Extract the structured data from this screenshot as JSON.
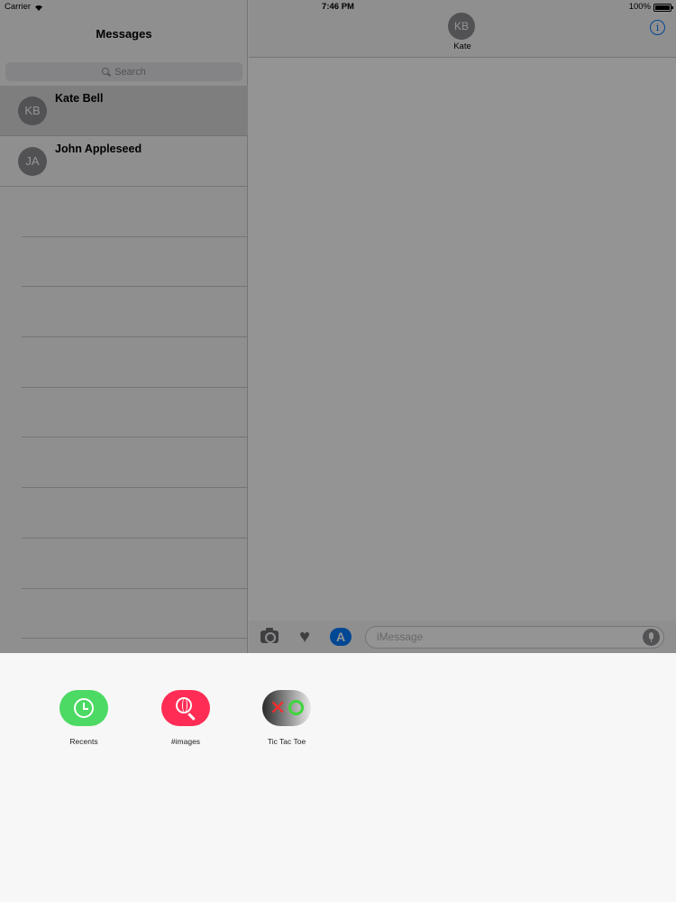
{
  "status_bar": {
    "carrier": "Carrier",
    "time": "7:46 PM",
    "battery": "100%"
  },
  "sidebar": {
    "title": "Messages",
    "search_placeholder": "Search",
    "conversations": [
      {
        "initials": "KB",
        "name": "Kate Bell",
        "selected": true
      },
      {
        "initials": "JA",
        "name": "John Appleseed",
        "selected": false
      }
    ]
  },
  "conversation": {
    "initials": "KB",
    "name": "Kate",
    "message_placeholder": "iMessage"
  },
  "drawer": {
    "apps": [
      {
        "label": "Recents",
        "icon": "clock-icon",
        "color": "#4cd964"
      },
      {
        "label": "#images",
        "icon": "globe-search-icon",
        "color": "#ff2d55"
      },
      {
        "label": "Tic Tac Toe",
        "icon": "tic-tac-toe-icon",
        "color": "#8a8a8a"
      }
    ]
  },
  "colors": {
    "accent": "#007aff",
    "overlay": "rgba(0,0,0,0.42)"
  }
}
